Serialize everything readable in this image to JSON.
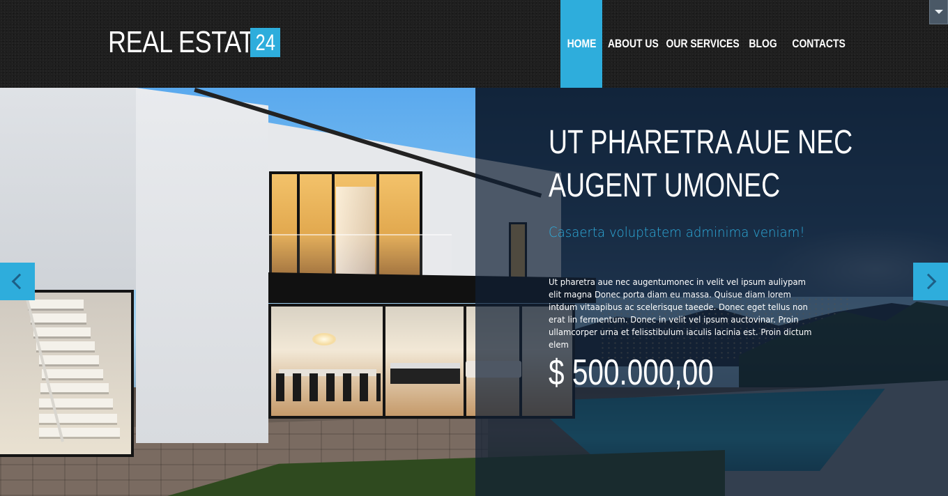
{
  "header": {
    "logo_text": "REAL ESTATE",
    "logo_badge": "24",
    "nav": [
      {
        "label": "HOME",
        "active": true
      },
      {
        "label": "ABOUT US",
        "active": false
      },
      {
        "label": "OUR SERVICES",
        "active": false
      },
      {
        "label": "BLOG",
        "active": false
      },
      {
        "label": "CONTACTS",
        "active": false
      }
    ],
    "corner_icon": "chevron-down-icon"
  },
  "slide": {
    "title_line1": "UT PHARETRA AUE NEC",
    "title_line2": "AUGENT UMONEC",
    "subtitle": "Casaerta voluptatem adminima veniam!",
    "body": "Ut pharetra aue nec augentumonec in velit vel ipsum auliypam elit magna Donec porta diam eu massa. Quisue diam lorem intdum vitaapibus ac scelerisque taeede. Donec eget tellus non erat lin fermentum. Donec in velit vel ipsum auctovinar. Proin ullamcorper urna et felisstibulum iaculis lacinia est. Proin dictum elem",
    "price": "$ 500.000,00",
    "prev_icon": "chevron-left-icon",
    "next_icon": "chevron-right-icon"
  },
  "colors": {
    "accent": "#2eaddc",
    "header_bg": "#1f1f1f",
    "overlay": "#102034"
  }
}
